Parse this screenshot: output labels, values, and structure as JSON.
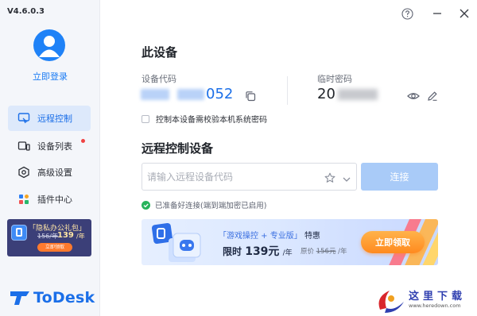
{
  "app": {
    "version": "V4.6.0.3",
    "brand_name": "ToDesk"
  },
  "sidebar": {
    "login_label": "立即登录",
    "items": [
      {
        "label": "远程控制",
        "icon": "remote-control-icon",
        "active": true
      },
      {
        "label": "设备列表",
        "icon": "device-list-icon",
        "active": false,
        "badge_dot": true
      },
      {
        "label": "高级设置",
        "icon": "settings-icon",
        "active": false
      },
      {
        "label": "插件中心",
        "icon": "plugin-icon",
        "active": false
      }
    ],
    "banner": {
      "title": "「隐私办公礼包」",
      "old_price": "156/年",
      "new_price": "139",
      "new_unit": "/年",
      "button": "立即领取"
    }
  },
  "window": {
    "help_icon": "help-icon",
    "minimize_icon": "minimize-icon",
    "close_icon": "close-icon"
  },
  "this_device": {
    "title": "此设备",
    "code_label": "设备代码",
    "code_visible": "052",
    "password_label": "临时密码",
    "password_visible": "20",
    "checkbox_label": "控制本设备需校验本机系统密码"
  },
  "remote": {
    "title": "远程控制设备",
    "input_placeholder": "请输入远程设备代码",
    "connect_label": "连接",
    "status_text": "已准备好连接(端到端加密已启用)"
  },
  "promo": {
    "title_accent": "「游戏操控 + 专业版」",
    "title_plain": "特惠",
    "price_prefix": "限时",
    "price": "139元",
    "price_unit": "/年",
    "old_prefix": "原价",
    "old_price": "156元",
    "old_unit": "/年",
    "button": "立即领取"
  },
  "watermark": {
    "title": "这里下载",
    "url": "www.heredown.com"
  },
  "colors": {
    "accent": "#1b6fe8",
    "connect_disabled": "#a9cbf8",
    "promo_button": "#ff8a1f"
  }
}
